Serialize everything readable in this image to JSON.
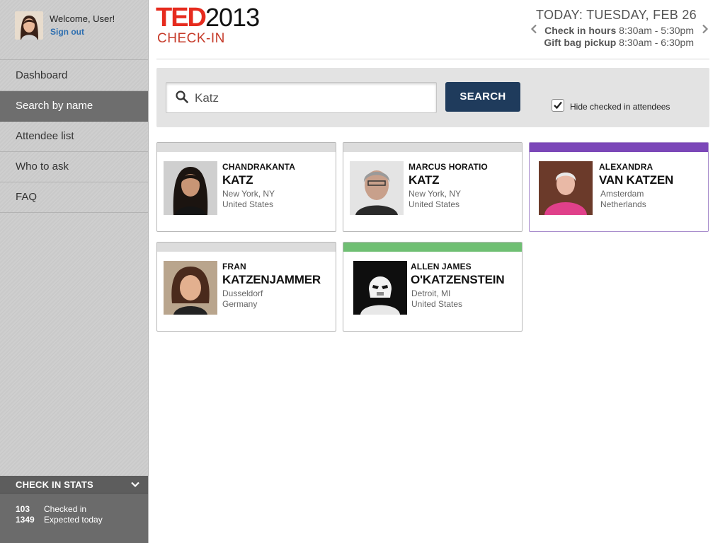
{
  "user": {
    "welcome": "Welcome, User!",
    "signout": "Sign out"
  },
  "nav": {
    "items": [
      {
        "label": "Dashboard"
      },
      {
        "label": "Search by name"
      },
      {
        "label": "Attendee list"
      },
      {
        "label": "Who to ask"
      },
      {
        "label": "FAQ"
      }
    ]
  },
  "stats": {
    "title": "CHECK IN STATS",
    "checked_in_count": "103",
    "checked_in_label": "Checked in",
    "expected_count": "1349",
    "expected_label": "Expected today"
  },
  "header": {
    "brand": "TED",
    "year": "2013",
    "subtitle": "CHECK-IN",
    "today": "TODAY: TUESDAY, FEB 26",
    "checkin_hours_label": "Check in hours",
    "checkin_hours_value": "8:30am - 5:30pm",
    "giftbag_label": "Gift bag pickup",
    "giftbag_value": "8:30am - 6:30pm"
  },
  "search": {
    "value": "Katz",
    "button_label": "SEARCH",
    "hide_checked_label": "Hide checked in attendees",
    "hide_checked": true
  },
  "colors": {
    "brand_red": "#e62b1e",
    "button_navy": "#1f3b5c",
    "status_purple": "#7b47b8",
    "status_green": "#6fbf73",
    "status_gray": "#dcdcdc"
  },
  "attendees": [
    {
      "first": "CHANDRAKANTA",
      "last": "KATZ",
      "city": "New York, NY",
      "country": "United States",
      "status": "gray",
      "photo_icon": "woman-portrait"
    },
    {
      "first": "MARCUS HORATIO",
      "last": "KATZ",
      "city": "New York, NY",
      "country": "United States",
      "status": "gray",
      "photo_icon": "man-portrait"
    },
    {
      "first": "ALEXANDRA",
      "last": "VAN KATZEN",
      "city": "Amsterdam",
      "country": "Netherlands",
      "status": "purple",
      "photo_icon": "elderly-woman-portrait"
    },
    {
      "first": "FRAN",
      "last": "KATZENJAMMER",
      "city": "Dusseldorf",
      "country": "Germany",
      "status": "gray",
      "photo_icon": "woman-portrait"
    },
    {
      "first": "ALLEN JAMES",
      "last": "O'KATZENSTEIN",
      "city": "Detroit, MI",
      "country": "United States",
      "status": "green",
      "photo_icon": "stormtrooper-portrait"
    }
  ]
}
